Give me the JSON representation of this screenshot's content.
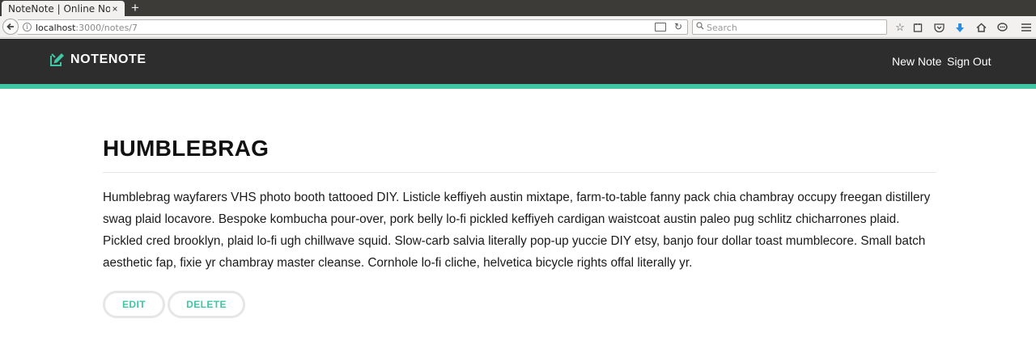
{
  "browser": {
    "tab_title": "NoteNote | Online Not…",
    "tab_close": "×",
    "new_tab": "+",
    "url_host": "localhost",
    "url_rest": ":3000/notes/7",
    "search_placeholder": "Search"
  },
  "header": {
    "brand": "NOTENOTE",
    "nav": {
      "new_note": "New Note",
      "sign_out": "Sign Out"
    }
  },
  "note": {
    "title": "HUMBLEBRAG",
    "body": "Humblebrag wayfarers VHS photo booth tattooed DIY. Listicle keffiyeh austin mixtape, farm-to-table fanny pack chia chambray occupy freegan distillery swag plaid locavore. Bespoke kombucha pour-over, pork belly lo-fi pickled keffiyeh cardigan waistcoat austin paleo pug schlitz chicharrones plaid. Pickled cred brooklyn, plaid lo-fi ugh chillwave squid. Slow-carb salvia literally pop-up yuccie DIY etsy, banjo four dollar toast mumblecore. Small batch aesthetic fap, fixie yr chambray master cleanse. Cornhole lo-fi cliche, helvetica bicycle rights offal literally yr."
  },
  "actions": {
    "edit": "EDIT",
    "delete": "DELETE"
  },
  "colors": {
    "accent": "#3fc6a4",
    "header_bg": "#2d2d2d"
  }
}
